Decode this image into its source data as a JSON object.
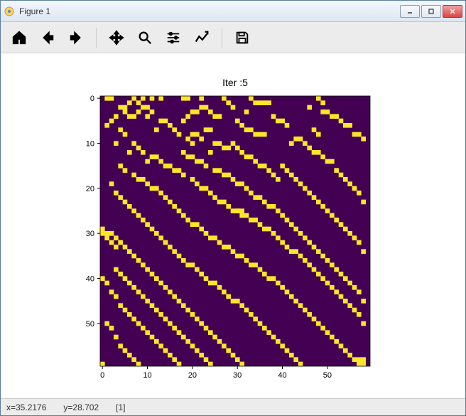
{
  "window": {
    "title": "Figure 1"
  },
  "toolbar": {
    "home": "Home",
    "back": "Back",
    "forward": "Forward",
    "pan": "Pan",
    "zoom": "Zoom",
    "subplots": "Configure subplots",
    "edit": "Edit",
    "save": "Save"
  },
  "status": {
    "x": "x=35.2176",
    "y": "y=28.702",
    "val": "[1]"
  },
  "chart_data": {
    "type": "heatmap",
    "title": "Iter :5",
    "xlabel": "",
    "ylabel": "",
    "xticks": [
      0,
      10,
      20,
      30,
      40,
      50
    ],
    "yticks": [
      0,
      10,
      20,
      30,
      40,
      50
    ],
    "xlim": [
      -0.5,
      59.5
    ],
    "ylim": [
      -0.5,
      59.5
    ],
    "colors": {
      "0": "#440154",
      "1": "#fde725"
    },
    "grid_size": 60,
    "note": "60x60 binary grid; detailed cell data approximated from screenshot",
    "cells_on": [
      [
        0,
        1
      ],
      [
        0,
        2
      ],
      [
        0,
        7
      ],
      [
        0,
        9
      ],
      [
        0,
        11
      ],
      [
        0,
        13
      ],
      [
        0,
        18
      ],
      [
        0,
        19
      ],
      [
        0,
        22
      ],
      [
        0,
        27
      ],
      [
        0,
        33
      ],
      [
        0,
        48
      ],
      [
        1,
        6
      ],
      [
        1,
        8
      ],
      [
        1,
        28
      ],
      [
        1,
        34
      ],
      [
        1,
        35
      ],
      [
        1,
        36
      ],
      [
        1,
        37
      ],
      [
        1,
        49
      ],
      [
        2,
        4
      ],
      [
        2,
        5
      ],
      [
        2,
        9
      ],
      [
        2,
        10
      ],
      [
        2,
        22
      ],
      [
        2,
        23
      ],
      [
        2,
        29
      ],
      [
        2,
        46
      ],
      [
        3,
        5
      ],
      [
        3,
        8
      ],
      [
        3,
        11
      ],
      [
        3,
        20
      ],
      [
        3,
        21
      ],
      [
        3,
        24
      ],
      [
        3,
        32
      ],
      [
        3,
        49
      ],
      [
        3,
        50
      ],
      [
        4,
        3
      ],
      [
        4,
        6
      ],
      [
        4,
        7
      ],
      [
        4,
        10
      ],
      [
        4,
        19
      ],
      [
        4,
        25
      ],
      [
        4,
        26
      ],
      [
        4,
        38
      ],
      [
        4,
        51
      ],
      [
        4,
        52
      ],
      [
        5,
        2
      ],
      [
        5,
        13
      ],
      [
        5,
        14
      ],
      [
        5,
        18
      ],
      [
        5,
        30
      ],
      [
        5,
        39
      ],
      [
        5,
        40
      ],
      [
        5,
        53
      ],
      [
        6,
        1
      ],
      [
        6,
        15
      ],
      [
        6,
        31
      ],
      [
        6,
        41
      ],
      [
        6,
        54
      ],
      [
        6,
        55
      ],
      [
        7,
        4
      ],
      [
        7,
        12
      ],
      [
        7,
        16
      ],
      [
        7,
        23
      ],
      [
        7,
        24
      ],
      [
        7,
        32
      ],
      [
        7,
        33
      ],
      [
        7,
        47
      ],
      [
        8,
        5
      ],
      [
        8,
        17
      ],
      [
        8,
        20
      ],
      [
        8,
        21
      ],
      [
        8,
        34
      ],
      [
        8,
        35
      ],
      [
        8,
        36
      ],
      [
        8,
        48
      ],
      [
        8,
        56
      ],
      [
        8,
        57
      ],
      [
        9,
        19
      ],
      [
        9,
        22
      ],
      [
        9,
        43
      ],
      [
        9,
        44
      ],
      [
        9,
        58
      ],
      [
        10,
        3
      ],
      [
        10,
        7
      ],
      [
        10,
        20
      ],
      [
        10,
        25
      ],
      [
        10,
        26
      ],
      [
        10,
        29
      ],
      [
        10,
        42
      ],
      [
        10,
        45
      ],
      [
        11,
        8
      ],
      [
        11,
        27
      ],
      [
        11,
        28
      ],
      [
        11,
        30
      ],
      [
        11,
        46
      ],
      [
        12,
        6
      ],
      [
        12,
        9
      ],
      [
        12,
        18
      ],
      [
        12,
        24
      ],
      [
        12,
        31
      ],
      [
        12,
        47
      ],
      [
        12,
        48
      ],
      [
        13,
        11
      ],
      [
        13,
        12
      ],
      [
        13,
        19
      ],
      [
        13,
        20
      ],
      [
        13,
        32
      ],
      [
        13,
        33
      ],
      [
        13,
        49
      ],
      [
        14,
        10
      ],
      [
        14,
        13
      ],
      [
        14,
        21
      ],
      [
        14,
        22
      ],
      [
        14,
        34
      ],
      [
        14,
        50
      ],
      [
        14,
        51
      ],
      [
        15,
        4
      ],
      [
        15,
        14
      ],
      [
        15,
        15
      ],
      [
        15,
        23
      ],
      [
        15,
        35
      ],
      [
        15,
        36
      ],
      [
        15,
        40
      ],
      [
        16,
        5
      ],
      [
        16,
        16
      ],
      [
        16,
        17
      ],
      [
        16,
        25
      ],
      [
        16,
        26
      ],
      [
        16,
        37
      ],
      [
        16,
        41
      ],
      [
        16,
        52
      ],
      [
        17,
        7
      ],
      [
        17,
        18
      ],
      [
        17,
        27
      ],
      [
        17,
        28
      ],
      [
        17,
        38
      ],
      [
        17,
        42
      ],
      [
        17,
        53
      ],
      [
        18,
        8
      ],
      [
        18,
        9
      ],
      [
        18,
        20
      ],
      [
        18,
        29
      ],
      [
        18,
        39
      ],
      [
        18,
        43
      ],
      [
        18,
        54
      ],
      [
        19,
        2
      ],
      [
        19,
        10
      ],
      [
        19,
        21
      ],
      [
        19,
        30
      ],
      [
        19,
        31
      ],
      [
        19,
        44
      ],
      [
        19,
        55
      ],
      [
        20,
        11
      ],
      [
        20,
        12
      ],
      [
        20,
        22
      ],
      [
        20,
        23
      ],
      [
        20,
        32
      ],
      [
        20,
        45
      ],
      [
        20,
        56
      ],
      [
        21,
        3
      ],
      [
        21,
        13
      ],
      [
        21,
        24
      ],
      [
        21,
        33
      ],
      [
        21,
        46
      ],
      [
        21,
        57
      ],
      [
        22,
        4
      ],
      [
        22,
        14
      ],
      [
        22,
        25
      ],
      [
        22,
        34
      ],
      [
        22,
        35
      ],
      [
        22,
        47
      ],
      [
        23,
        5
      ],
      [
        23,
        15
      ],
      [
        23,
        26
      ],
      [
        23,
        27
      ],
      [
        23,
        36
      ],
      [
        23,
        48
      ],
      [
        23,
        58
      ],
      [
        24,
        6
      ],
      [
        24,
        16
      ],
      [
        24,
        28
      ],
      [
        24,
        37
      ],
      [
        24,
        38
      ],
      [
        24,
        49
      ],
      [
        25,
        7
      ],
      [
        25,
        17
      ],
      [
        25,
        29
      ],
      [
        25,
        30
      ],
      [
        25,
        30
      ],
      [
        25,
        31
      ],
      [
        25,
        39
      ],
      [
        25,
        50
      ],
      [
        26,
        8
      ],
      [
        26,
        18
      ],
      [
        26,
        31
      ],
      [
        26,
        32
      ],
      [
        26,
        40
      ],
      [
        26,
        51
      ],
      [
        27,
        9
      ],
      [
        27,
        19
      ],
      [
        27,
        33
      ],
      [
        27,
        34
      ],
      [
        27,
        41
      ],
      [
        27,
        52
      ],
      [
        28,
        10
      ],
      [
        28,
        20
      ],
      [
        28,
        21
      ],
      [
        28,
        35
      ],
      [
        28,
        42
      ],
      [
        28,
        53
      ],
      [
        29,
        0
      ],
      [
        29,
        11
      ],
      [
        29,
        22
      ],
      [
        29,
        36
      ],
      [
        29,
        37
      ],
      [
        29,
        43
      ],
      [
        29,
        54
      ],
      [
        30,
        0
      ],
      [
        30,
        1
      ],
      [
        30,
        2
      ],
      [
        30,
        12
      ],
      [
        30,
        23
      ],
      [
        30,
        38
      ],
      [
        30,
        44
      ],
      [
        30,
        55
      ],
      [
        31,
        1
      ],
      [
        31,
        3
      ],
      [
        31,
        13
      ],
      [
        31,
        24
      ],
      [
        31,
        25
      ],
      [
        31,
        39
      ],
      [
        31,
        45
      ],
      [
        31,
        56
      ],
      [
        32,
        2
      ],
      [
        32,
        4
      ],
      [
        32,
        14
      ],
      [
        32,
        26
      ],
      [
        32,
        40
      ],
      [
        32,
        46
      ],
      [
        32,
        57
      ],
      [
        33,
        3
      ],
      [
        33,
        5
      ],
      [
        33,
        15
      ],
      [
        33,
        27
      ],
      [
        33,
        28
      ],
      [
        33,
        41
      ],
      [
        33,
        47
      ],
      [
        34,
        6
      ],
      [
        34,
        16
      ],
      [
        34,
        29
      ],
      [
        34,
        42
      ],
      [
        34,
        43
      ],
      [
        34,
        48
      ],
      [
        34,
        58
      ],
      [
        35,
        7
      ],
      [
        35,
        17
      ],
      [
        35,
        30
      ],
      [
        35,
        31
      ],
      [
        35,
        44
      ],
      [
        35,
        49
      ],
      [
        36,
        8
      ],
      [
        36,
        18
      ],
      [
        36,
        32
      ],
      [
        36,
        45
      ],
      [
        36,
        50
      ],
      [
        37,
        9
      ],
      [
        37,
        19
      ],
      [
        37,
        20
      ],
      [
        37,
        33
      ],
      [
        37,
        34
      ],
      [
        37,
        46
      ],
      [
        37,
        51
      ],
      [
        38,
        3
      ],
      [
        38,
        10
      ],
      [
        38,
        21
      ],
      [
        38,
        35
      ],
      [
        38,
        47
      ],
      [
        38,
        52
      ],
      [
        39,
        4
      ],
      [
        39,
        11
      ],
      [
        39,
        22
      ],
      [
        39,
        36
      ],
      [
        39,
        48
      ],
      [
        39,
        53
      ],
      [
        40,
        0
      ],
      [
        40,
        5
      ],
      [
        40,
        12
      ],
      [
        40,
        23
      ],
      [
        40,
        37
      ],
      [
        40,
        38
      ],
      [
        40,
        49
      ],
      [
        40,
        54
      ],
      [
        41,
        1
      ],
      [
        41,
        6
      ],
      [
        41,
        13
      ],
      [
        41,
        24
      ],
      [
        41,
        25
      ],
      [
        41,
        39
      ],
      [
        41,
        50
      ],
      [
        41,
        55
      ],
      [
        42,
        7
      ],
      [
        42,
        14
      ],
      [
        42,
        26
      ],
      [
        42,
        40
      ],
      [
        42,
        51
      ],
      [
        42,
        56
      ],
      [
        43,
        2
      ],
      [
        43,
        8
      ],
      [
        43,
        15
      ],
      [
        43,
        27
      ],
      [
        43,
        41
      ],
      [
        43,
        52
      ],
      [
        43,
        57
      ],
      [
        44,
        3
      ],
      [
        44,
        9
      ],
      [
        44,
        16
      ],
      [
        44,
        28
      ],
      [
        44,
        42
      ],
      [
        44,
        53
      ],
      [
        45,
        10
      ],
      [
        45,
        17
      ],
      [
        45,
        29
      ],
      [
        45,
        30
      ],
      [
        45,
        43
      ],
      [
        45,
        54
      ],
      [
        45,
        58
      ],
      [
        46,
        4
      ],
      [
        46,
        11
      ],
      [
        46,
        18
      ],
      [
        46,
        31
      ],
      [
        46,
        44
      ],
      [
        46,
        55
      ],
      [
        47,
        5
      ],
      [
        47,
        12
      ],
      [
        47,
        19
      ],
      [
        47,
        32
      ],
      [
        47,
        45
      ],
      [
        47,
        56
      ],
      [
        48,
        6
      ],
      [
        48,
        13
      ],
      [
        48,
        20
      ],
      [
        48,
        33
      ],
      [
        48,
        46
      ],
      [
        48,
        57
      ],
      [
        49,
        7
      ],
      [
        49,
        14
      ],
      [
        49,
        21
      ],
      [
        49,
        34
      ],
      [
        49,
        47
      ],
      [
        50,
        1
      ],
      [
        50,
        8
      ],
      [
        50,
        15
      ],
      [
        50,
        22
      ],
      [
        50,
        35
      ],
      [
        50,
        48
      ],
      [
        50,
        58
      ],
      [
        51,
        2
      ],
      [
        51,
        9
      ],
      [
        51,
        16
      ],
      [
        51,
        23
      ],
      [
        51,
        36
      ],
      [
        51,
        49
      ],
      [
        52,
        10
      ],
      [
        52,
        17
      ],
      [
        52,
        24
      ],
      [
        52,
        37
      ],
      [
        52,
        50
      ],
      [
        53,
        3
      ],
      [
        53,
        11
      ],
      [
        53,
        18
      ],
      [
        53,
        25
      ],
      [
        53,
        38
      ],
      [
        53,
        51
      ],
      [
        54,
        12
      ],
      [
        54,
        19
      ],
      [
        54,
        26
      ],
      [
        54,
        39
      ],
      [
        54,
        52
      ],
      [
        55,
        4
      ],
      [
        55,
        13
      ],
      [
        55,
        20
      ],
      [
        55,
        27
      ],
      [
        55,
        40
      ],
      [
        55,
        53
      ],
      [
        56,
        5
      ],
      [
        56,
        14
      ],
      [
        56,
        21
      ],
      [
        56,
        28
      ],
      [
        56,
        41
      ],
      [
        56,
        54
      ],
      [
        57,
        6
      ],
      [
        57,
        15
      ],
      [
        57,
        22
      ],
      [
        57,
        29
      ],
      [
        57,
        42
      ],
      [
        57,
        55
      ],
      [
        58,
        7
      ],
      [
        58,
        16
      ],
      [
        58,
        23
      ],
      [
        58,
        30
      ],
      [
        58,
        43
      ],
      [
        58,
        56
      ],
      [
        58,
        57
      ],
      [
        58,
        58
      ],
      [
        59,
        0
      ],
      [
        59,
        8
      ],
      [
        59,
        17
      ],
      [
        59,
        24
      ],
      [
        59,
        31
      ],
      [
        59,
        44
      ],
      [
        59,
        57
      ],
      [
        59,
        58
      ]
    ]
  }
}
